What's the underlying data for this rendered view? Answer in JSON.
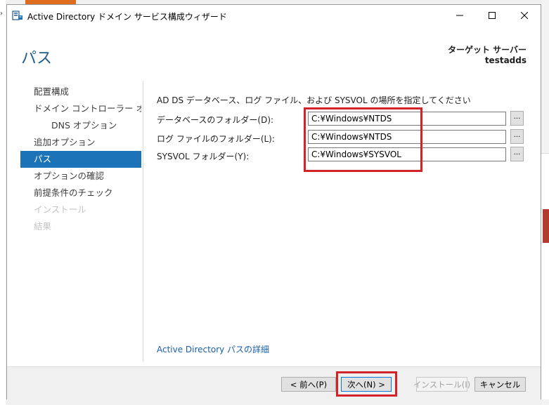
{
  "window": {
    "title": "Active Directory ドメイン サービス構成ウィザード",
    "controls": {
      "minimize": "—",
      "maximize": "☐",
      "close": "✕"
    }
  },
  "header": {
    "page_title": "パス",
    "target_server_label": "ターゲット サーバー",
    "target_server_name": "testadds"
  },
  "nav": {
    "items": [
      {
        "label": "配置構成",
        "state": "normal"
      },
      {
        "label": "ドメイン コントローラー オプシ...",
        "state": "normal"
      },
      {
        "label": "DNS オプション",
        "state": "sub"
      },
      {
        "label": "追加オプション",
        "state": "normal"
      },
      {
        "label": "パス",
        "state": "active"
      },
      {
        "label": "オプションの確認",
        "state": "normal"
      },
      {
        "label": "前提条件のチェック",
        "state": "normal"
      },
      {
        "label": "インストール",
        "state": "disabled"
      },
      {
        "label": "結果",
        "state": "disabled"
      }
    ]
  },
  "content": {
    "instruction": "AD DS データベース、ログ ファイル、および SYSVOL の場所を指定してください",
    "fields": [
      {
        "label": "データベースのフォルダー(D):",
        "value": "C:¥Windows¥NTDS",
        "browse": "..."
      },
      {
        "label": "ログ ファイルのフォルダー(L):",
        "value": "C:¥Windows¥NTDS",
        "browse": "..."
      },
      {
        "label": "SYSVOL フォルダー(Y):",
        "value": "C:¥Windows¥SYSVOL",
        "browse": "..."
      }
    ],
    "details_link": "Active Directory パスの詳細"
  },
  "footer": {
    "back": "< 前へ(P)",
    "next": "次へ(N) >",
    "install": "インストール(I)",
    "cancel": "キャンセル"
  },
  "colors": {
    "accent": "#1d73b8",
    "heading": "#1f5d8a",
    "highlight": "#d2232a",
    "link": "#1a5fa8"
  }
}
